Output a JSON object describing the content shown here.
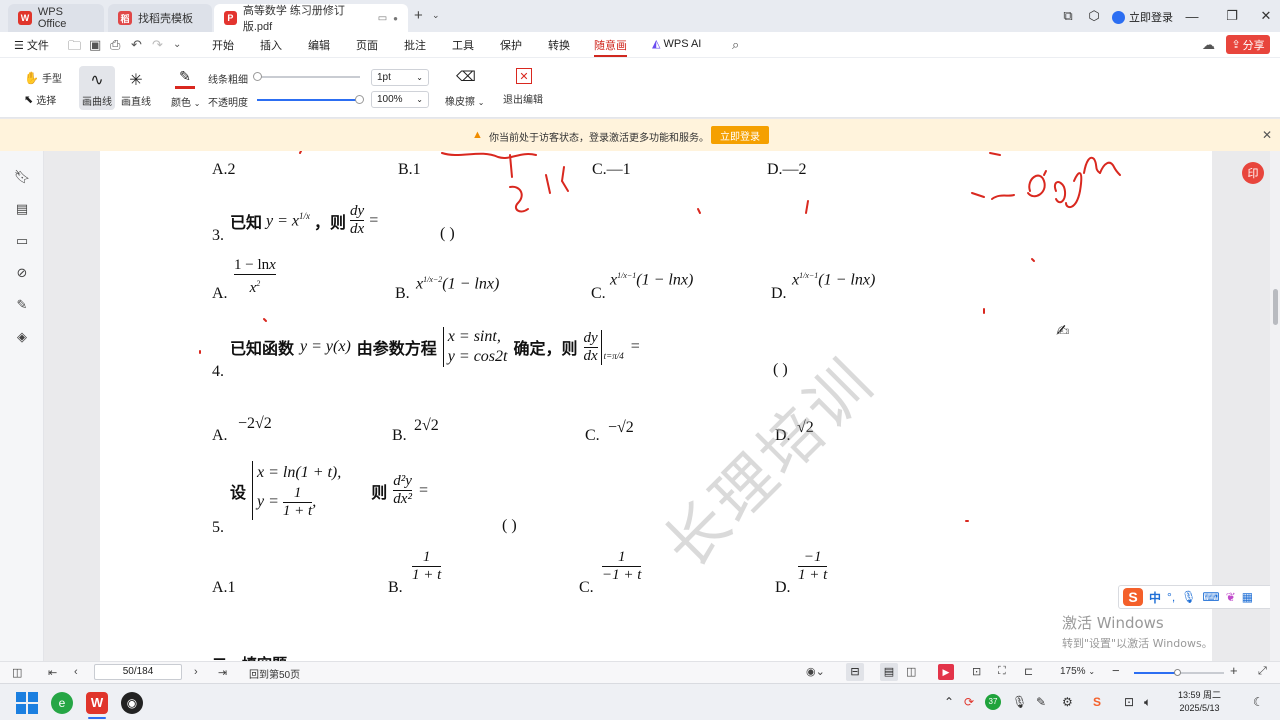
{
  "titlebar": {
    "tabs": [
      {
        "label": "WPS Office"
      },
      {
        "label": "找稻壳模板"
      },
      {
        "label": "高等数学 练习册修订版.pdf"
      }
    ],
    "login": "立即登录"
  },
  "menubar": {
    "file": "文件",
    "items": [
      "开始",
      "插入",
      "编辑",
      "页面",
      "批注",
      "工具",
      "保护",
      "转换",
      "随意画",
      "WPS AI"
    ],
    "active": "随意画",
    "share": "分享"
  },
  "toolbar": {
    "hand": "手型",
    "select": "选择",
    "curve": "画曲线",
    "line": "画直线",
    "color": "颜色",
    "stroke_label": "线条粗细",
    "stroke_value": "1pt",
    "opacity_label": "不透明度",
    "opacity_value": "100%",
    "eraser": "橡皮擦",
    "exit": "退出编辑",
    "stroke_color": "#d9281f"
  },
  "notice": {
    "text": "你当前处于访客状态，登录激活更多功能和服务。",
    "button": "立即登录"
  },
  "document": {
    "q2_options": [
      "A.2",
      "B.1",
      "C.—1",
      "D.—2"
    ],
    "q3": {
      "num": "3.",
      "stem_cn": "已知",
      "stem_mid": "，则",
      "paren": "(    )",
      "labels": [
        "A.",
        "B.",
        "C.",
        "D."
      ]
    },
    "q4": {
      "num": "4.",
      "stem": "已知函数",
      "stem2": "由参数方程",
      "stem3": "确定，则",
      "paren": "(    )",
      "labels": [
        "A.",
        "B.",
        "C.",
        "D."
      ]
    },
    "q5": {
      "num": "5.",
      "stem": "设",
      "stem2": "则",
      "paren": "(    )",
      "labels": [
        "A.1",
        "B.",
        "C.",
        "D."
      ]
    },
    "next_section": "二、填空题",
    "watermark": "长理培训"
  },
  "statusbar": {
    "page_input": "50/184",
    "back": "回到第50页",
    "zoom": "175%"
  },
  "activation": {
    "title": "激活 Windows",
    "subtitle": "转到\"设置\"以激活 Windows。"
  },
  "ime": {
    "label": "中"
  },
  "taskbar": {
    "time": "13:59 周二",
    "date": "2025/5/13"
  }
}
